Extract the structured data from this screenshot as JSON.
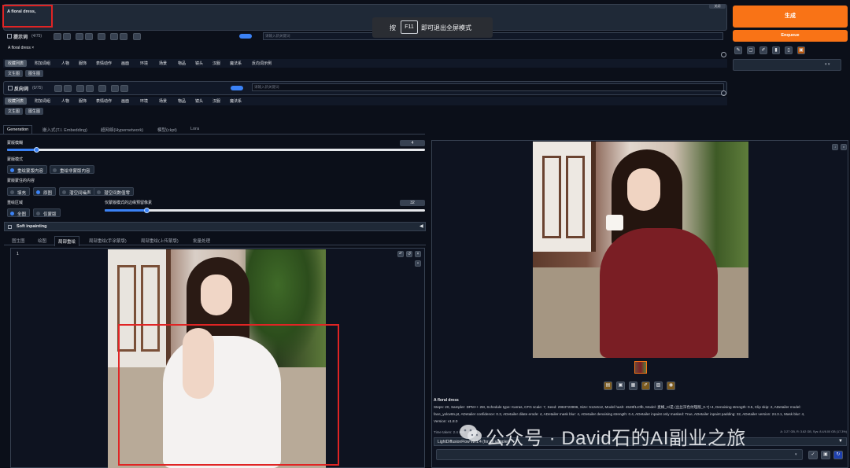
{
  "prompt": {
    "text": "A floral dress,",
    "top_right_btn": "关闭",
    "label": "提示词",
    "token_count": "(4/75)",
    "input_placeholder": "请输入新关键词",
    "preview": "A floral dress ×"
  },
  "fullscreen_hint": {
    "pre": "按",
    "key": "F11",
    "post": "即可退出全屏模式"
  },
  "generate_btn": "生成",
  "enqueue_btn": "Enqueue",
  "category_tabs": [
    "收藏列表",
    "附加词组",
    "人物",
    "服饰",
    "表情动作",
    "画面",
    "环境",
    "场景",
    "物品",
    "镜头",
    "汉服",
    "魔法系",
    "反向词示例"
  ],
  "sub_chips": [
    "文生图",
    "图生图"
  ],
  "negative": {
    "label": "反向词",
    "token_count": "(0/75)",
    "input_placeholder": "请输入新关键词"
  },
  "main_tabs": [
    "Generation",
    "嵌入式(T.I. Embedding)",
    "超网络(Hypernetwork)",
    "模型(ckpt)",
    "Lora"
  ],
  "denoise": {
    "label": "蒙版模糊",
    "value": "4",
    "fraction": 0.07
  },
  "mask_mode": {
    "label": "蒙版模式",
    "options": [
      "重绘蒙版内容",
      "重绘非蒙版内容"
    ],
    "selected": 0
  },
  "masked_content": {
    "label": "蒙版蒙住的内容",
    "options": [
      "填充",
      "原图",
      "潜空间噪声",
      "潜空间数值零"
    ],
    "selected": 1
  },
  "inpaint_area": {
    "label": "重绘区域",
    "options": [
      "全图",
      "仅蒙版"
    ],
    "selected": 0
  },
  "padding": {
    "label": "仅蒙版模式的边缘预留像素",
    "value": "32",
    "fraction": 0.13
  },
  "soft_inpainting": "Soft inpainting",
  "img_tabs": [
    "图生图",
    "绘图",
    "局部重绘",
    "局部重绘(手涂蒙版)",
    "局部重绘(上传蒙版)",
    "批量处理"
  ],
  "img_tab_active": 2,
  "canvas_label": "1",
  "info": {
    "title": "A floral dress",
    "line1": "Steps: 20, Sampler: DPM++ 2M, Schedule type: Karras, CFG scale: 7, Seed: 2963723996, Size: 512x512, Model hash: 4528f1c0fb, Model: 麦橘_Cl是 (丝丝深色纹理版_0.7)+4, Denoising strength: 0.5, Clip skip: 2, ADetailer model:",
    "line2": "face_yolov8n.pt, ADetailer confidence: 0.3, ADetailer dilate erode: 4, ADetailer mask blur: 4, ADetailer denoising strength: 0.4, ADetailer inpaint only masked: True, ADetailer inpaint padding: 32, ADetailer version: 24.3.1, Mask blur: 4,",
    "line3": "Version: v1.8.0",
    "time": "Time taken: 2.4 sec.",
    "vram": "A: 3.27 GB, R: 3.62 GB, Sys: 8.4/8.00 GB (17.3%)"
  },
  "lightdiffusion": "LightDiffusionFlow v2.1.4 (for all sampler)",
  "watermark": "公众号 · David石的AI副业之旅",
  "colors": {
    "accent": "#f97316",
    "bg": "#0b0f19",
    "panel": "#1f2937",
    "highlight": "#e02424"
  }
}
